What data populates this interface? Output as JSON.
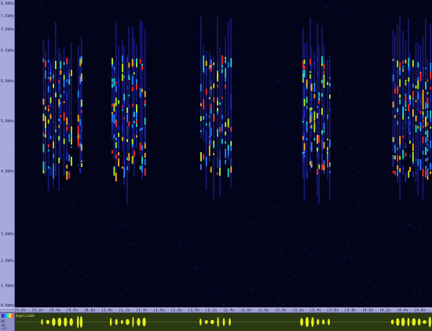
{
  "window": {
    "title": ""
  },
  "frequency_axis": {
    "labels": [
      "8.0kHz",
      "7.5kHz",
      "7.0kHz",
      "6.5kHz",
      "6.0kHz",
      "5.0kHz",
      "4.0kHz",
      "3.0kHz",
      "2.0kHz",
      "1.0kHz",
      "0.0kHz"
    ]
  },
  "time_axis": {
    "labels": [
      "0.0s",
      "0.2s",
      "0.4s",
      "0.6s",
      "0.8s",
      "1.0s",
      "1.2s",
      "1.4s",
      "1.6s",
      "1.8s",
      "2.0s",
      "2.2s",
      "2.4s",
      "2.6s",
      "2.8s",
      "3.0s",
      "3.2s",
      "3.4s",
      "3.6s",
      "3.8s",
      "4.0s",
      "4.2s",
      "4.4s",
      "4.6s"
    ]
  },
  "waveform_panel": {
    "header_labels": [
      "dB",
      "+0",
      "-24"
    ],
    "track_label": "Angelica01"
  },
  "colors": {
    "ruler_bg": "#a8a8dc",
    "spectrogram_bg": "#03041a",
    "waveform_bg": "#2b3a12",
    "waveform_color": "#e6f020"
  },
  "spectrogram": {
    "calls": [
      {
        "center": 0.1,
        "width": 0.07
      },
      {
        "center": 0.155,
        "width": 0.008
      },
      {
        "center": 0.27,
        "width": 0.08
      },
      {
        "center": 0.48,
        "width": 0.07
      },
      {
        "center": 0.72,
        "width": 0.065
      },
      {
        "center": 0.95,
        "width": 0.09
      }
    ]
  }
}
